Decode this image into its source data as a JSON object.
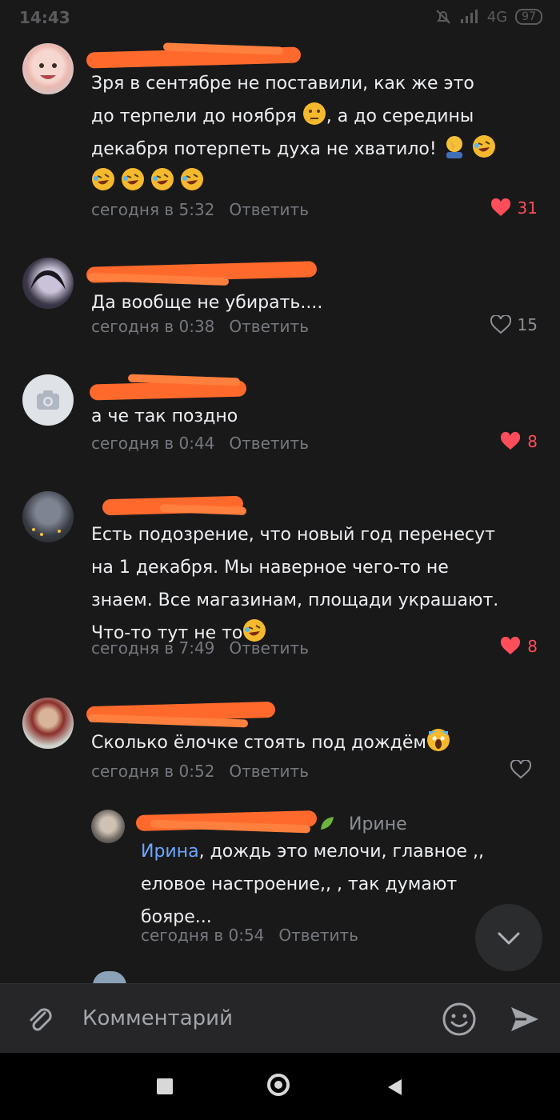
{
  "status": {
    "time": "14:43",
    "network": "4G",
    "battery": "97"
  },
  "comments": [
    {
      "text": "Зря в сентябре не поставили, как же это до терпели до ноября 🤔, а до середины декабря потерпеть духа не хватило! 🤦‍♂️🤣 🤣🤣🤣🤣",
      "text_line1": "Зря в сентябре не поставили, как же это",
      "text_line2a": "до терпели до ноября ",
      "text_line2b": ", а до середины",
      "text_line3": "декабря потерпеть духа не хватило! ",
      "time": "сегодня в 5:32",
      "reply_label": "Ответить",
      "likes": "31",
      "liked": true
    },
    {
      "text": "Да вообще не убирать....",
      "time": "сегодня в 0:38",
      "reply_label": "Ответить",
      "likes": "15",
      "liked": false
    },
    {
      "text": "а че так поздно",
      "time": "сегодня в 0:44",
      "reply_label": "Ответить",
      "likes": "8",
      "liked": true
    },
    {
      "text_line1": "Есть подозрение, что новый год перенесут",
      "text_line2": "на 1 декабря. Мы наверное чего-то не",
      "text_line3": "знаем. Все магазинам, площади украшают.",
      "text_line4": "Что-то тут не  то",
      "time": "сегодня в 7:49",
      "reply_label": "Ответить",
      "likes": "8",
      "liked": true
    },
    {
      "text": "Сколько ёлочке стоять под дождём",
      "time": "сегодня в 0:52",
      "reply_label": "Ответить",
      "likes": "",
      "liked": false
    }
  ],
  "reply": {
    "reply_to": "Ирине",
    "mention": "Ирина",
    "text_line1_rest": ", дождь это мелочи, главное ,,",
    "text_line2": "еловое настроение,, , так думают",
    "text_line3": "бояре...",
    "time": "сегодня в 0:54",
    "reply_label": "Ответить"
  },
  "composer": {
    "placeholder": "Комментарий"
  },
  "colors": {
    "background": "#19191a",
    "like_active": "#ff4d5a",
    "mention": "#6ea7ff",
    "redaction": "#ff6a2c"
  },
  "icons": [
    "camera-icon",
    "heart-icon",
    "chevron-down-icon",
    "attach-icon",
    "smile-icon",
    "send-icon"
  ]
}
